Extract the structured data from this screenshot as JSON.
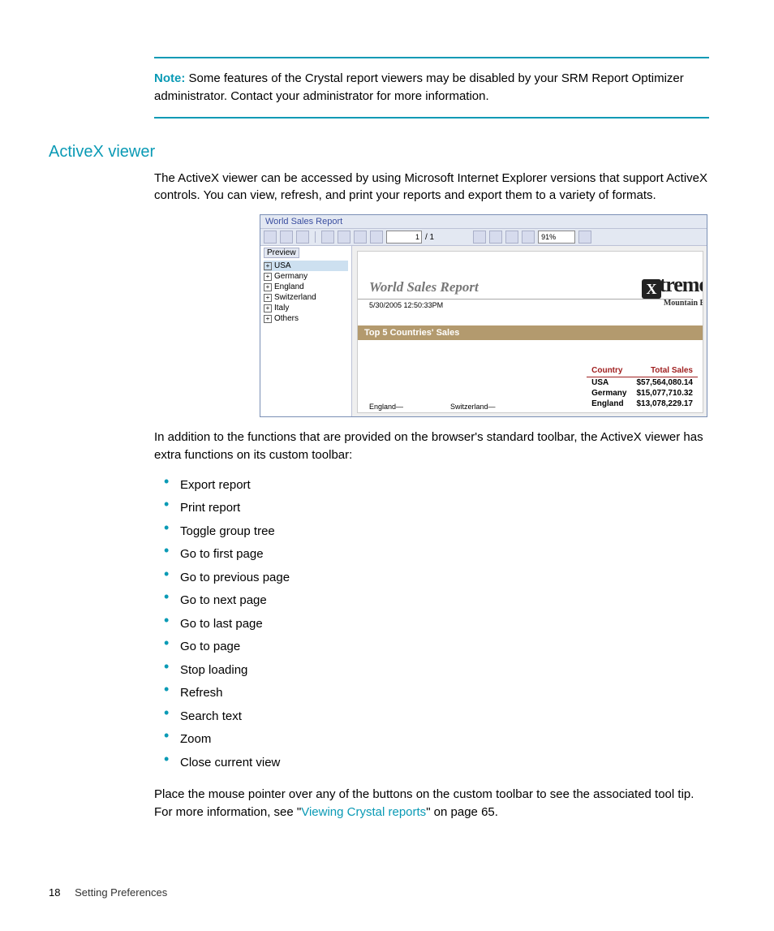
{
  "note": {
    "label": "Note:",
    "text": "Some features of the Crystal report viewers may be disabled by your SRM Report Optimizer administrator. Contact your administrator for more information."
  },
  "heading": "ActiveX viewer",
  "intro": "The ActiveX viewer can be accessed by using Microsoft Internet Explorer versions that support ActiveX controls. You can view, refresh, and print your reports and export them to a variety of formats.",
  "figure": {
    "title": "World Sales Report",
    "page_current": "1",
    "page_total": "/ 1",
    "zoom": "91%",
    "tab": "Preview",
    "tree": [
      "USA",
      "Germany",
      "England",
      "Switzerland",
      "Italy",
      "Others"
    ],
    "report_title": "World Sales Report",
    "report_date": "5/30/2005  12:50:33PM",
    "logo_big": "treme",
    "logo_sub": "Mountain Bi",
    "band": "Top 5 Countries' Sales",
    "table_head_a": "Country",
    "table_head_b": "Total Sales",
    "rows": [
      {
        "c": "USA",
        "v": "$57,564,080.14"
      },
      {
        "c": "Germany",
        "v": "$15,077,710.32"
      },
      {
        "c": "England",
        "v": "$13,078,229.17"
      }
    ],
    "chart_labels": [
      "England",
      "Switzerland"
    ]
  },
  "mid_para": "In addition to the functions that are provided on the browser's standard toolbar, the ActiveX viewer has extra functions on its custom toolbar:",
  "bullets": [
    "Export report",
    "Print report",
    "Toggle group tree",
    "Go to first page",
    "Go to previous page",
    "Go to next page",
    "Go to last page",
    "Go to page",
    "Stop loading",
    "Refresh",
    "Search text",
    "Zoom",
    "Close current view"
  ],
  "tail": {
    "pre": "Place the mouse pointer over any of the buttons on the custom toolbar to see the associated tool tip. For more information, see \"",
    "link": "Viewing Crystal reports",
    "post": "\" on page 65."
  },
  "footer": {
    "page": "18",
    "section": "Setting Preferences"
  }
}
